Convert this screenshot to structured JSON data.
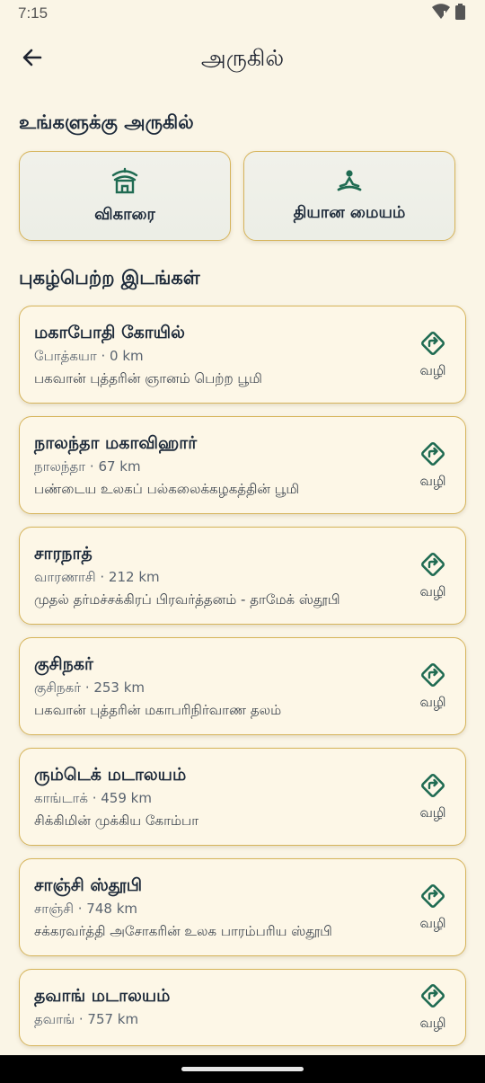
{
  "status": {
    "time": "7:15",
    "icons": [
      "wifi-icon",
      "battery-icon"
    ]
  },
  "app_bar": {
    "back_icon": "arrow-left-icon",
    "title": "அருகில்"
  },
  "nearby": {
    "heading": "உங்களுக்கு அருகில்",
    "cards": [
      {
        "label": "விகாரை",
        "icon": "temple-icon"
      },
      {
        "label": "தியான மையம்",
        "icon": "meditation-icon"
      }
    ]
  },
  "famous": {
    "heading": "புகழ்பெற்ற இடங்கள்",
    "route_label": "வழி",
    "places": [
      {
        "name": "மகாபோதி கோயில்",
        "meta": "போத்கயா · 0 km",
        "desc": "பகவான் புத்தரின் ஞானம் பெற்ற பூமி"
      },
      {
        "name": "நாலந்தா மகாவிஹார்",
        "meta": "நாலந்தா · 67 km",
        "desc": "பண்டைய உலகப் பல்கலைக்கழகத்தின் பூமி"
      },
      {
        "name": "சாரநாத்",
        "meta": "வாரணாசி · 212 km",
        "desc": "முதல் தர்மச்சக்கிரப் பிரவர்த்தனம் - தாமேக் ஸ்தூபி"
      },
      {
        "name": "குசிநகர்",
        "meta": "குசிநகர் · 253 km",
        "desc": "பகவான் புத்தரின் மகாபரிநிர்வாண தலம்"
      },
      {
        "name": "ரும்டெக் மடாலயம்",
        "meta": "காங்டாக் · 459 km",
        "desc": "சிக்கிமின் முக்கிய கோம்பா"
      },
      {
        "name": "சாஞ்சி ஸ்தூபி",
        "meta": "சாஞ்சி · 748 km",
        "desc": "சக்கரவர்த்தி அசோகரின் உலக பாரம்பரிய ஸ்தூபி"
      },
      {
        "name": "தவாங் மடாலயம்",
        "meta": "தவாங் · 757 km",
        "desc": ""
      }
    ]
  },
  "colors": {
    "background": "#faf5e6",
    "card_border": "#d6b45a",
    "accent_green": "#1f6b52"
  }
}
